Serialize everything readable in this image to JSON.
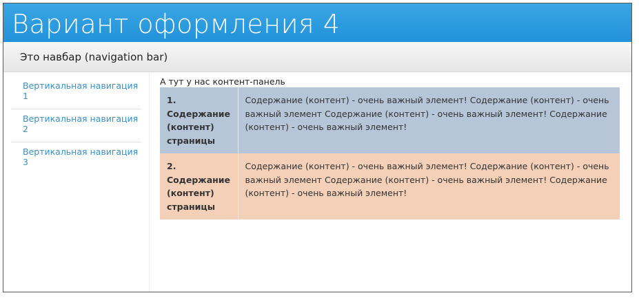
{
  "header": {
    "title": "Вариант оформления 4"
  },
  "navbar": {
    "text": "Это навбар (navigation bar)"
  },
  "sidebar": {
    "items": [
      {
        "label": "Вертикальная навигация 1"
      },
      {
        "label": "Вертикальная навигация 2"
      },
      {
        "label": "Вертикальная навигация 3"
      }
    ]
  },
  "content": {
    "label": "А тут у нас контент-панель",
    "rows": [
      {
        "title": "1. Содержание (контент) страницы",
        "text": "Содержание (контент) - очень важный элемент! Содержание (контент) - очень важный элемент Содержание (контент) - очень важный элемент! Содержание (контент) - очень важный элемент!",
        "color": "#b6c6d8"
      },
      {
        "title": "2. Содержание (контент) страницы",
        "text": "Содержание (контент) - очень важный элемент! Содержание (контент) - очень важный элемент Содержание (контент) - очень важный элемент! Содержание (контент) - очень важный элемент!",
        "color": "#f4d0b8"
      }
    ]
  },
  "colors": {
    "header": "#2a9ade",
    "link": "#3a8fc4"
  }
}
